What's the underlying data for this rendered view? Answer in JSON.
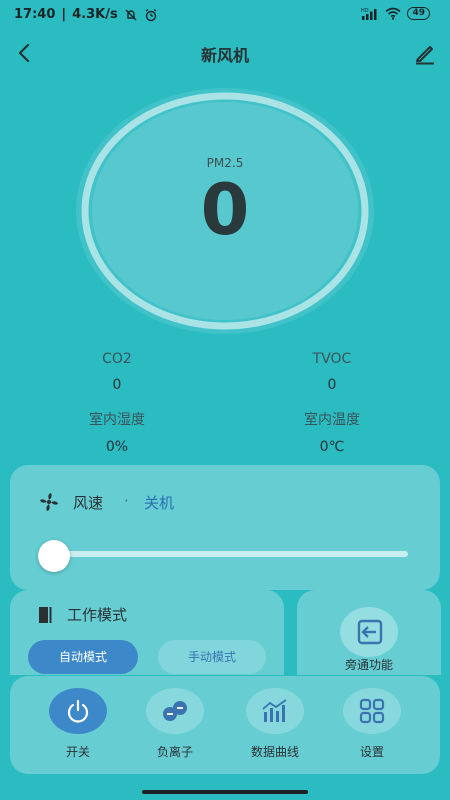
{
  "status_bar": {
    "time": "17:40",
    "net_speed": "4.3K/s",
    "battery": "49",
    "signal_tag": "HD"
  },
  "header": {
    "title": "新风机"
  },
  "gauge": {
    "label": "PM2.5",
    "value": "0"
  },
  "metrics": {
    "co2_label": "CO2",
    "co2_value": "0",
    "tvoc_label": "TVOC",
    "tvoc_value": "0",
    "humidity_label": "室内湿度",
    "humidity_value": "0%",
    "temp_label": "室内温度",
    "temp_value": "0℃"
  },
  "fan": {
    "label": "风速",
    "separator": "·",
    "state": "关机",
    "level": 0
  },
  "mode": {
    "title": "工作模式",
    "auto_label": "自动模式",
    "manual_label": "手动模式",
    "selected": "自动模式"
  },
  "special": {
    "label": "旁通功能"
  },
  "nav": {
    "power": "开关",
    "anion": "负离子",
    "chart": "数据曲线",
    "settings": "设置"
  },
  "colors": {
    "background": "#2bbcc2",
    "accent_blue": "#3d88c8",
    "text_dark": "#2a3133"
  }
}
